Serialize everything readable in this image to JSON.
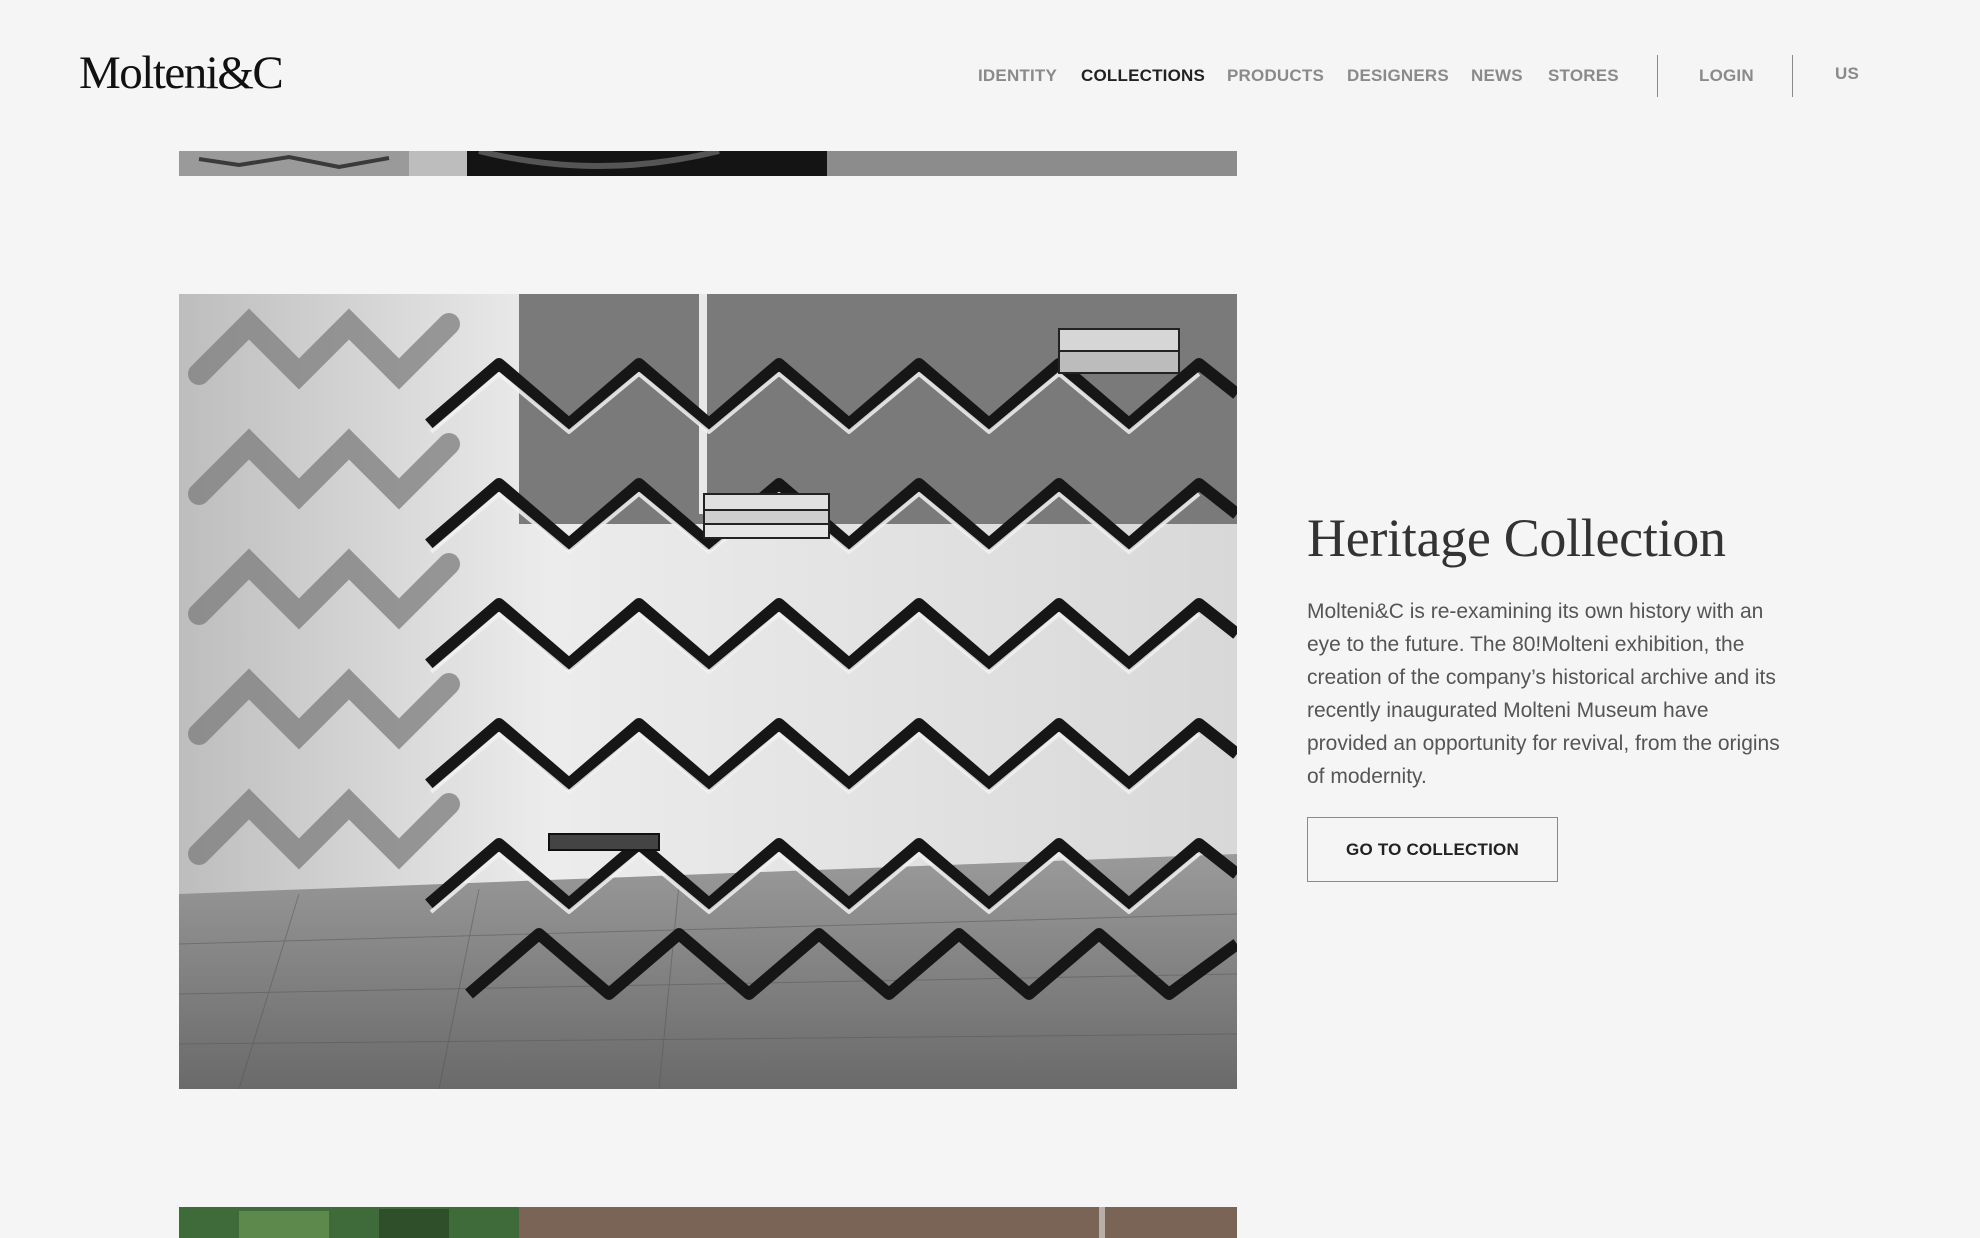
{
  "brand": {
    "logo_text": "Molteni&C"
  },
  "nav": {
    "items": [
      {
        "label": "IDENTITY",
        "active": false
      },
      {
        "label": "COLLECTIONS",
        "active": true
      },
      {
        "label": "PRODUCTS",
        "active": false
      },
      {
        "label": "DESIGNERS",
        "active": false
      },
      {
        "label": "NEWS",
        "active": false
      },
      {
        "label": "STORES",
        "active": false
      }
    ],
    "login_label": "LOGIN",
    "region_label": "US"
  },
  "feature": {
    "title": "Heritage Collection",
    "description": "Molteni&C is re-examining its own history with an eye to the future. The 80!Molteni exhibition, the creation of the company’s historical archive and its recently inaugurated Molteni Museum have provided an opportunity for revival, from the origins of modernity.",
    "cta_label": "GO TO COLLECTION"
  },
  "colors": {
    "background": "#f5f5f5",
    "text_dark": "#333333",
    "nav_inactive": "#8a8a8a",
    "nav_active": "#222222"
  }
}
